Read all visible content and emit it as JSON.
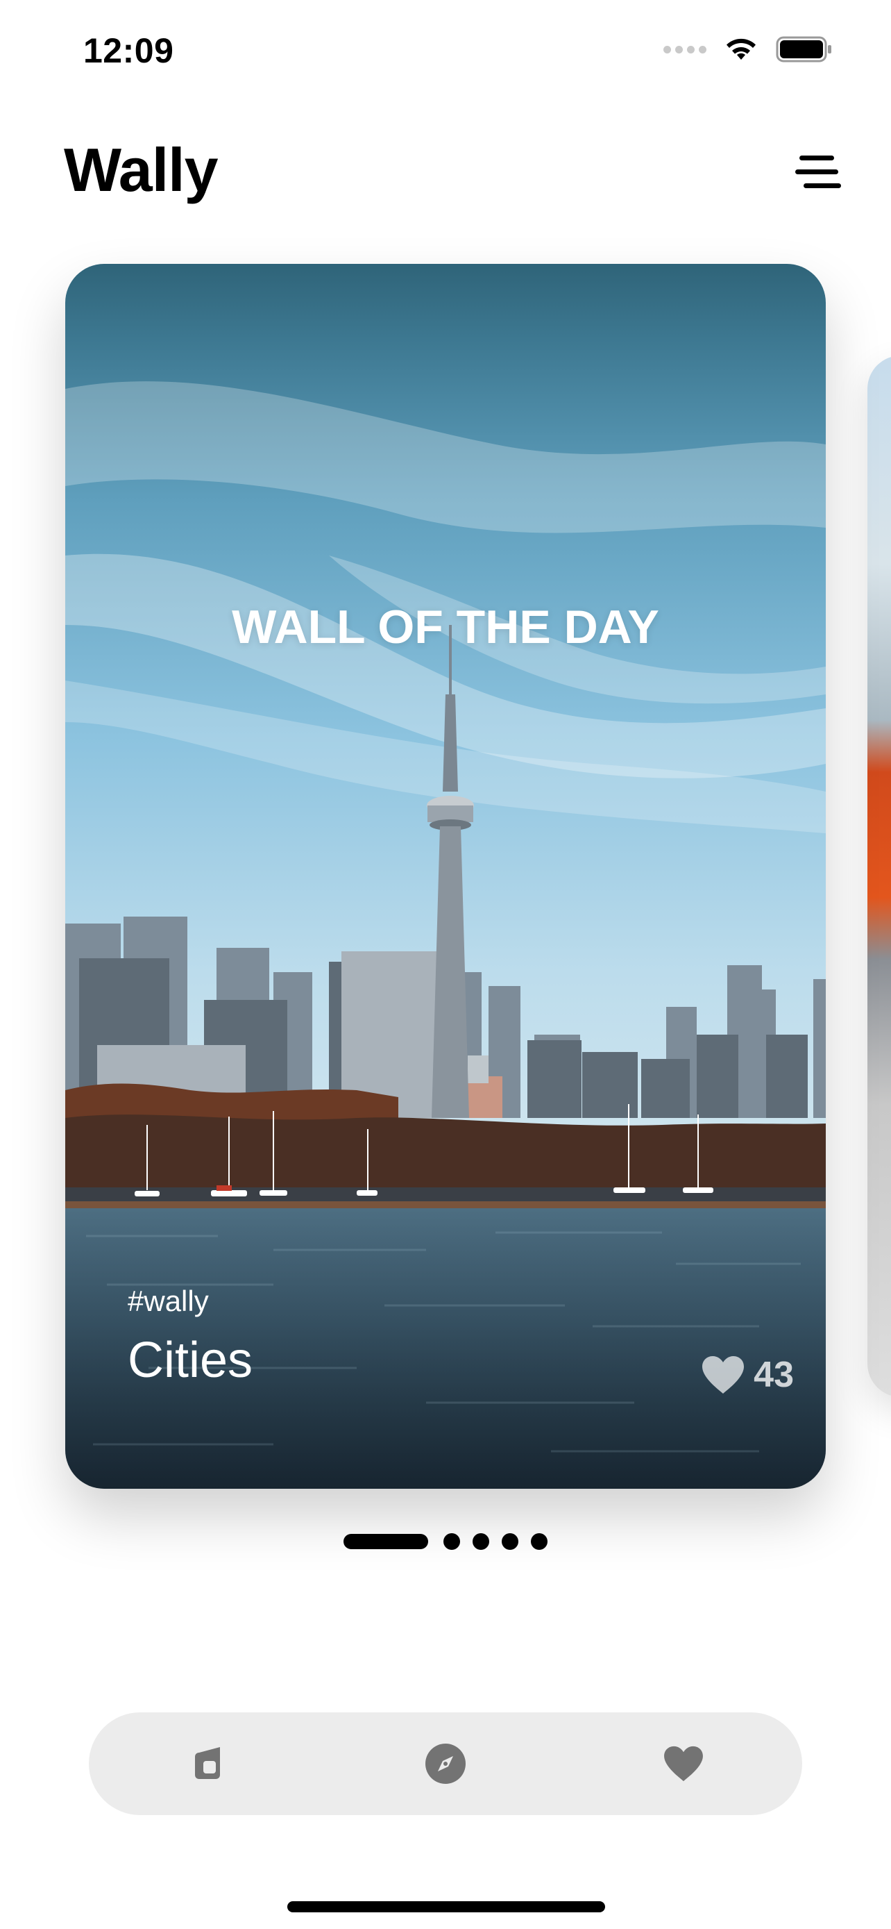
{
  "status_bar": {
    "time": "12:09",
    "icons": [
      "cellular-signal-icon",
      "wifi-icon",
      "battery-icon"
    ]
  },
  "header": {
    "title": "Wally",
    "menu_icon": "menu-icon"
  },
  "featured_card": {
    "heading": "WALL OF THE DAY",
    "tag": "#wally",
    "category": "Cities",
    "likes": "43",
    "like_icon": "heart-icon"
  },
  "pager": {
    "total_pages": 5,
    "active_page": 1
  },
  "bottom_nav": {
    "items": [
      {
        "icon": "wallpaper-icon"
      },
      {
        "icon": "compass-icon"
      },
      {
        "icon": "heart-icon"
      }
    ]
  },
  "colors": {
    "background": "#ffffff",
    "text": "#000000",
    "nav_background": "#ececec",
    "nav_icon": "#737373"
  }
}
